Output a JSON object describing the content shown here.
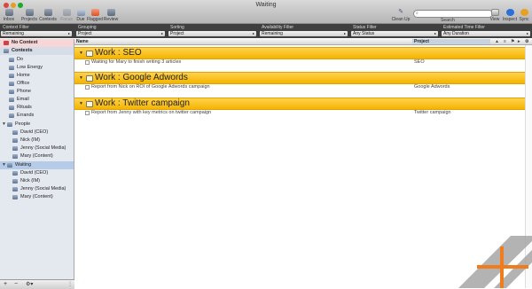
{
  "window": {
    "title": "Waiting"
  },
  "toolbar": {
    "buttons": [
      {
        "label": "Inbox",
        "icon": "inbox-icon",
        "enabled": true
      },
      {
        "label": "Projects",
        "icon": "projects-icon",
        "enabled": true
      },
      {
        "label": "Contexts",
        "icon": "contexts-icon",
        "enabled": true
      },
      {
        "label": "Focus",
        "icon": "focus-icon",
        "enabled": false
      },
      {
        "label": "Due",
        "icon": "due-icon",
        "enabled": true
      },
      {
        "label": "Flagged",
        "icon": "flagged-icon",
        "enabled": true
      },
      {
        "label": "Review",
        "icon": "review-icon",
        "enabled": true
      }
    ],
    "cleanup_label": "Clean Up",
    "search_label": "Search",
    "search_placeholder": "",
    "view_label": "View",
    "inspect_label": "Inspect",
    "sync_label": "Sync"
  },
  "filters": [
    {
      "title": "Context Filter",
      "value": "Remaining"
    },
    {
      "title": "Grouping",
      "value": "Project"
    },
    {
      "title": "Sorting",
      "value": "Project"
    },
    {
      "title": "Availability Filter",
      "value": "Remaining"
    },
    {
      "title": "Status Filter",
      "value": "Any Status"
    },
    {
      "title": "Estimated Time Filter",
      "value": "Any Duration"
    }
  ],
  "sidebar": {
    "no_context": "No Context",
    "contexts_header": "Contexts",
    "contexts": [
      "Do",
      "Low Energy",
      "Home",
      "Office",
      "Phone",
      "Email",
      "Rituals",
      "Errands"
    ],
    "people_header": "People",
    "people": [
      "David (CEO)",
      "Nick (IM)",
      "Jenny (Social Media)",
      "Mary (Content)"
    ],
    "waiting_header": "Waiting",
    "waiting": [
      "David (CEO)",
      "Nick (IM)",
      "Jenny (Social Media)",
      "Mary (Content)"
    ],
    "bottom": {
      "add": "+",
      "remove": "−",
      "gear": "⚙▾"
    }
  },
  "columns": {
    "name": "Name",
    "project": "Project"
  },
  "groups": [
    {
      "title": "Work : SEO",
      "tasks": [
        {
          "name": "Waiting for Mary to finish writing 3 articles",
          "project": "SEO"
        }
      ]
    },
    {
      "title": "Work : Google Adwords",
      "tasks": [
        {
          "name": "Report from Nick on ROI of Google Adwords campaign",
          "project": "Google Adwords"
        }
      ]
    },
    {
      "title": "Work : Twitter campaign",
      "tasks": [
        {
          "name": "Report from Jenny with key metrics on twitter campaign",
          "project": "Twitter campaign"
        }
      ]
    }
  ],
  "colors": {
    "group_header": "#f4b400",
    "filter_bar": "#3f3f3f",
    "sidebar": "#e4e9ef",
    "logo_orange": "#f07c1e",
    "logo_gray": "#a6a6a6"
  }
}
